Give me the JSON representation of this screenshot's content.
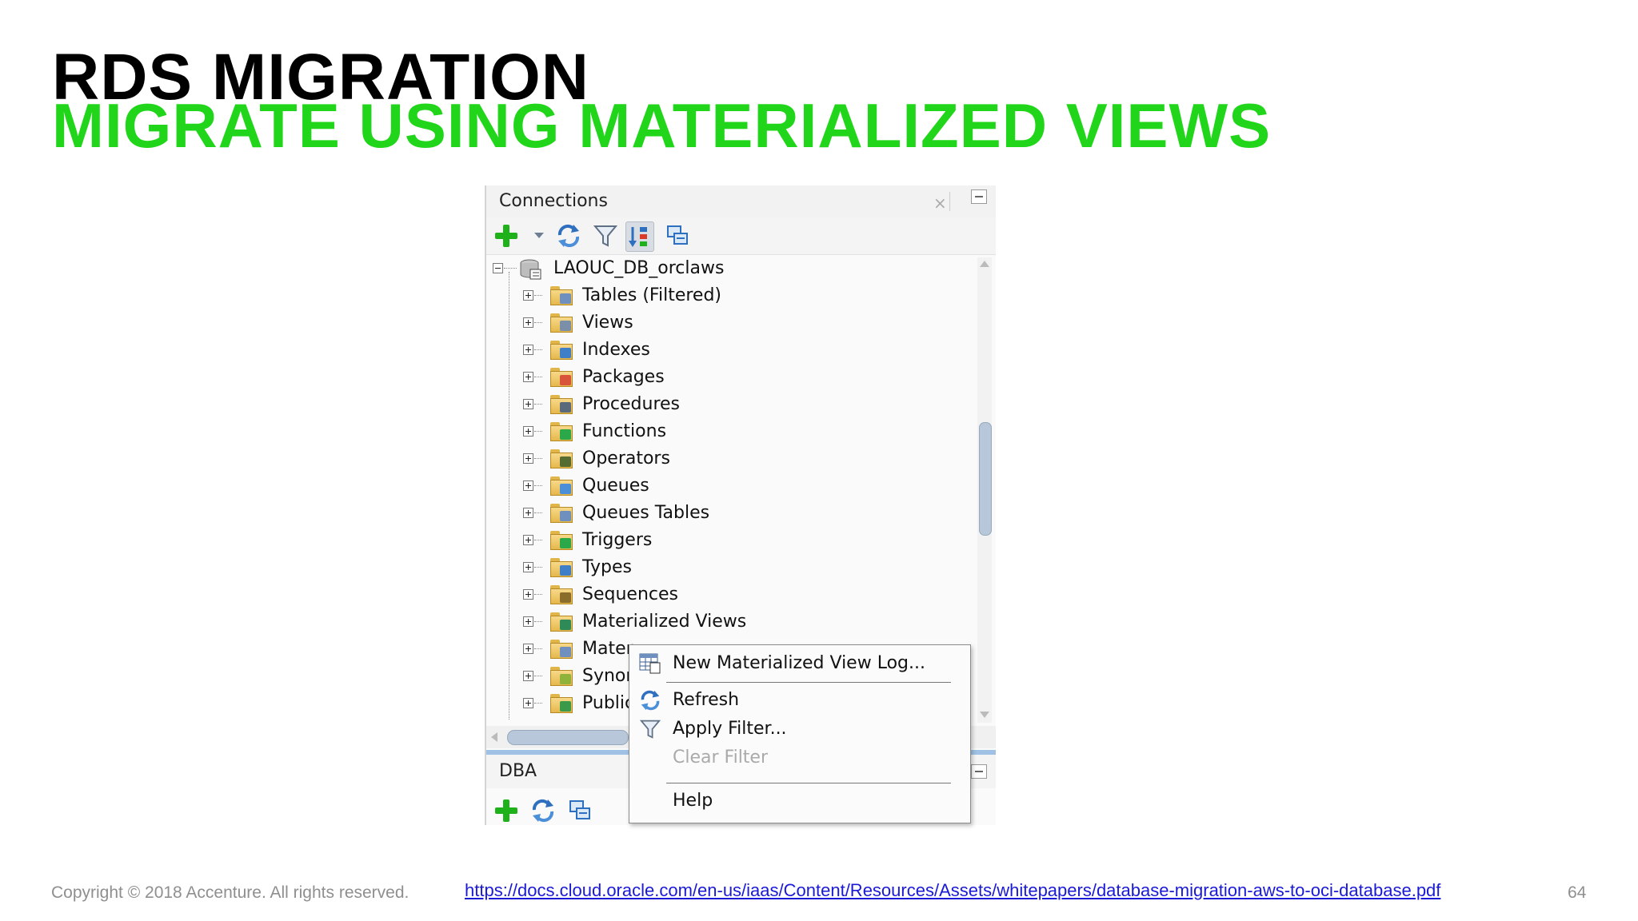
{
  "slide": {
    "title": "RDS MIGRATION",
    "subtitle": "MIGRATE USING MATERIALIZED VIEWS",
    "copyright": "Copyright © 2018 Accenture. All rights reserved.",
    "link": "https://docs.cloud.oracle.com/en-us/iaas/Content/Resources/Assets/whitepapers/database-migration-aws-to-oci-database.pdf",
    "page_number": "64",
    "accent_color": "#21d61a"
  },
  "connections_panel": {
    "title": "Connections",
    "toolbar": [
      "add-icon",
      "dropdown-arrow-icon",
      "refresh-icon",
      "filter-icon",
      "schema-browser-icon",
      "collapse-icon"
    ],
    "connection_name": "LAOUC_DB_orclaws",
    "tree_items": [
      {
        "label": "Tables (Filtered)",
        "icon": "tables-folder-icon"
      },
      {
        "label": "Views",
        "icon": "views-folder-icon"
      },
      {
        "label": "Indexes",
        "icon": "indexes-folder-icon"
      },
      {
        "label": "Packages",
        "icon": "packages-folder-icon"
      },
      {
        "label": "Procedures",
        "icon": "procedures-folder-icon"
      },
      {
        "label": "Functions",
        "icon": "functions-folder-icon"
      },
      {
        "label": "Operators",
        "icon": "operators-folder-icon"
      },
      {
        "label": "Queues",
        "icon": "queues-folder-icon"
      },
      {
        "label": "Queues Tables",
        "icon": "queues-tables-folder-icon"
      },
      {
        "label": "Triggers",
        "icon": "triggers-folder-icon"
      },
      {
        "label": "Types",
        "icon": "types-folder-icon"
      },
      {
        "label": "Sequences",
        "icon": "sequences-folder-icon"
      },
      {
        "label": "Materialized Views",
        "icon": "materialized-views-folder-icon"
      },
      {
        "label": "Mater",
        "icon": "materialized-view-logs-folder-icon"
      },
      {
        "label": "Synor",
        "icon": "synonyms-folder-icon"
      },
      {
        "label": "Public",
        "icon": "public-synonyms-folder-icon"
      }
    ]
  },
  "dba_panel": {
    "title": "DBA"
  },
  "context_menu": {
    "items": [
      {
        "label": "New Materialized View Log...",
        "selected": true,
        "disabled": false
      },
      {
        "label": "Refresh",
        "selected": false,
        "disabled": false
      },
      {
        "label": "Apply Filter...",
        "selected": false,
        "disabled": false
      },
      {
        "label": "Clear Filter",
        "selected": false,
        "disabled": true
      },
      {
        "label": "Help",
        "selected": false,
        "disabled": false
      }
    ]
  }
}
